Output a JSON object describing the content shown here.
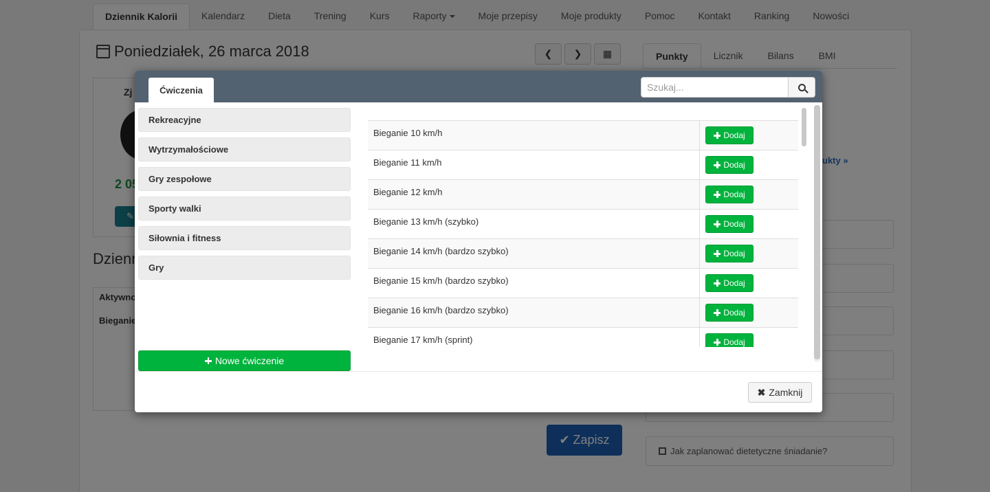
{
  "topnav": {
    "items": [
      {
        "label": "Dziennik Kalorii",
        "active": true
      },
      {
        "label": "Kalendarz"
      },
      {
        "label": "Dieta"
      },
      {
        "label": "Trening"
      },
      {
        "label": "Kurs"
      },
      {
        "label": "Raporty",
        "dropdown": true
      },
      {
        "label": "Moje przepisy"
      },
      {
        "label": "Moje produkty"
      },
      {
        "label": "Pomoc"
      },
      {
        "label": "Kontakt"
      },
      {
        "label": "Ranking"
      },
      {
        "label": "Nowości"
      }
    ]
  },
  "page": {
    "date_title": "Poniedziałek, 26 marca 2018",
    "side_tabs": [
      "Punkty",
      "Licznik",
      "Bilans",
      "BMI"
    ],
    "left_header_fragment": "Zj",
    "green_value_fragment": "2 05",
    "diary_title_fragment": "Dzienn",
    "diary_row1_fragment": "Aktywno",
    "diary_row2_fragment": "Bieganie",
    "save_label": "Zapisz",
    "link_fragment": "ukty »",
    "tip_label": "Jak zaplanować dietetyczne śniadanie?"
  },
  "modal": {
    "tab_label": "Ćwiczenia",
    "search_placeholder": "Szukaj...",
    "categories": [
      "Rekreacyjne",
      "Wytrzymałościowe",
      "Gry zespołowe",
      "Sporty walki",
      "Siłownia i fitness",
      "Gry"
    ],
    "new_button_label": "Nowe ćwiczenie",
    "add_label": "Dodaj",
    "exercises": [
      "Bieganie 10 km/h",
      "Bieganie 11 km/h",
      "Bieganie 12 km/h",
      "Bieganie 13 km/h (szybko)",
      "Bieganie 14 km/h (bardzo szybko)",
      "Bieganie 15 km/h (bardzo szybko)",
      "Bieganie 16 km/h (bardzo szybko)",
      "Bieganie 17 km/h (sprint)"
    ],
    "close_label": "Zamknij"
  },
  "colors": {
    "modal_header": "#526270",
    "green": "#00b33c",
    "save_blue": "#1a5fb4"
  }
}
